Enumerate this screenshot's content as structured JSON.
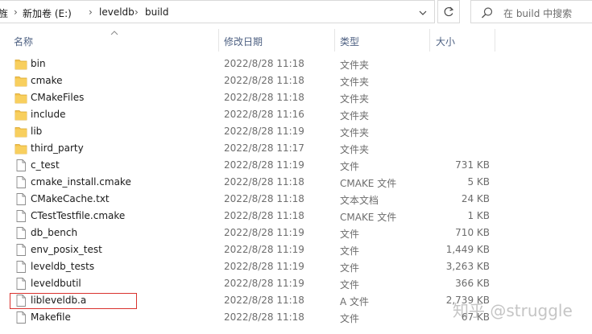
{
  "address": {
    "crumbs": [
      "旌",
      "新加卷 (E:)",
      "leveldb",
      "build"
    ],
    "separator": "›"
  },
  "search": {
    "placeholder": "在 build 中搜索"
  },
  "columns": {
    "name": "名称",
    "date": "修改日期",
    "type": "类型",
    "size": "大小"
  },
  "files": [
    {
      "name": "bin",
      "date": "2022/8/28 11:18",
      "type": "文件夹",
      "size": "",
      "kind": "folder"
    },
    {
      "name": "cmake",
      "date": "2022/8/28 11:18",
      "type": "文件夹",
      "size": "",
      "kind": "folder"
    },
    {
      "name": "CMakeFiles",
      "date": "2022/8/28 11:18",
      "type": "文件夹",
      "size": "",
      "kind": "folder"
    },
    {
      "name": "include",
      "date": "2022/8/28 11:16",
      "type": "文件夹",
      "size": "",
      "kind": "folder"
    },
    {
      "name": "lib",
      "date": "2022/8/28 11:19",
      "type": "文件夹",
      "size": "",
      "kind": "folder"
    },
    {
      "name": "third_party",
      "date": "2022/8/28 11:17",
      "type": "文件夹",
      "size": "",
      "kind": "folder"
    },
    {
      "name": "c_test",
      "date": "2022/8/28 11:19",
      "type": "文件",
      "size": "731 KB",
      "kind": "file"
    },
    {
      "name": "cmake_install.cmake",
      "date": "2022/8/28 11:18",
      "type": "CMAKE 文件",
      "size": "5 KB",
      "kind": "file"
    },
    {
      "name": "CMakeCache.txt",
      "date": "2022/8/28 11:18",
      "type": "文本文档",
      "size": "24 KB",
      "kind": "file"
    },
    {
      "name": "CTestTestfile.cmake",
      "date": "2022/8/28 11:18",
      "type": "CMAKE 文件",
      "size": "1 KB",
      "kind": "file"
    },
    {
      "name": "db_bench",
      "date": "2022/8/28 11:19",
      "type": "文件",
      "size": "710 KB",
      "kind": "file"
    },
    {
      "name": "env_posix_test",
      "date": "2022/8/28 11:19",
      "type": "文件",
      "size": "1,449 KB",
      "kind": "file"
    },
    {
      "name": "leveldb_tests",
      "date": "2022/8/28 11:19",
      "type": "文件",
      "size": "3,263 KB",
      "kind": "file"
    },
    {
      "name": "leveldbutil",
      "date": "2022/8/28 11:19",
      "type": "文件",
      "size": "366 KB",
      "kind": "file"
    },
    {
      "name": "libleveldb.a",
      "date": "2022/8/28 11:18",
      "type": "A 文件",
      "size": "2,739 KB",
      "kind": "file"
    },
    {
      "name": "Makefile",
      "date": "2022/8/28 11:18",
      "type": "文件",
      "size": "67 KB",
      "kind": "file"
    }
  ],
  "watermark": "知乎 @struggle",
  "colors": {
    "folder": "#f3c14a",
    "header_text": "#4d6082",
    "highlight": "#d9322e"
  }
}
